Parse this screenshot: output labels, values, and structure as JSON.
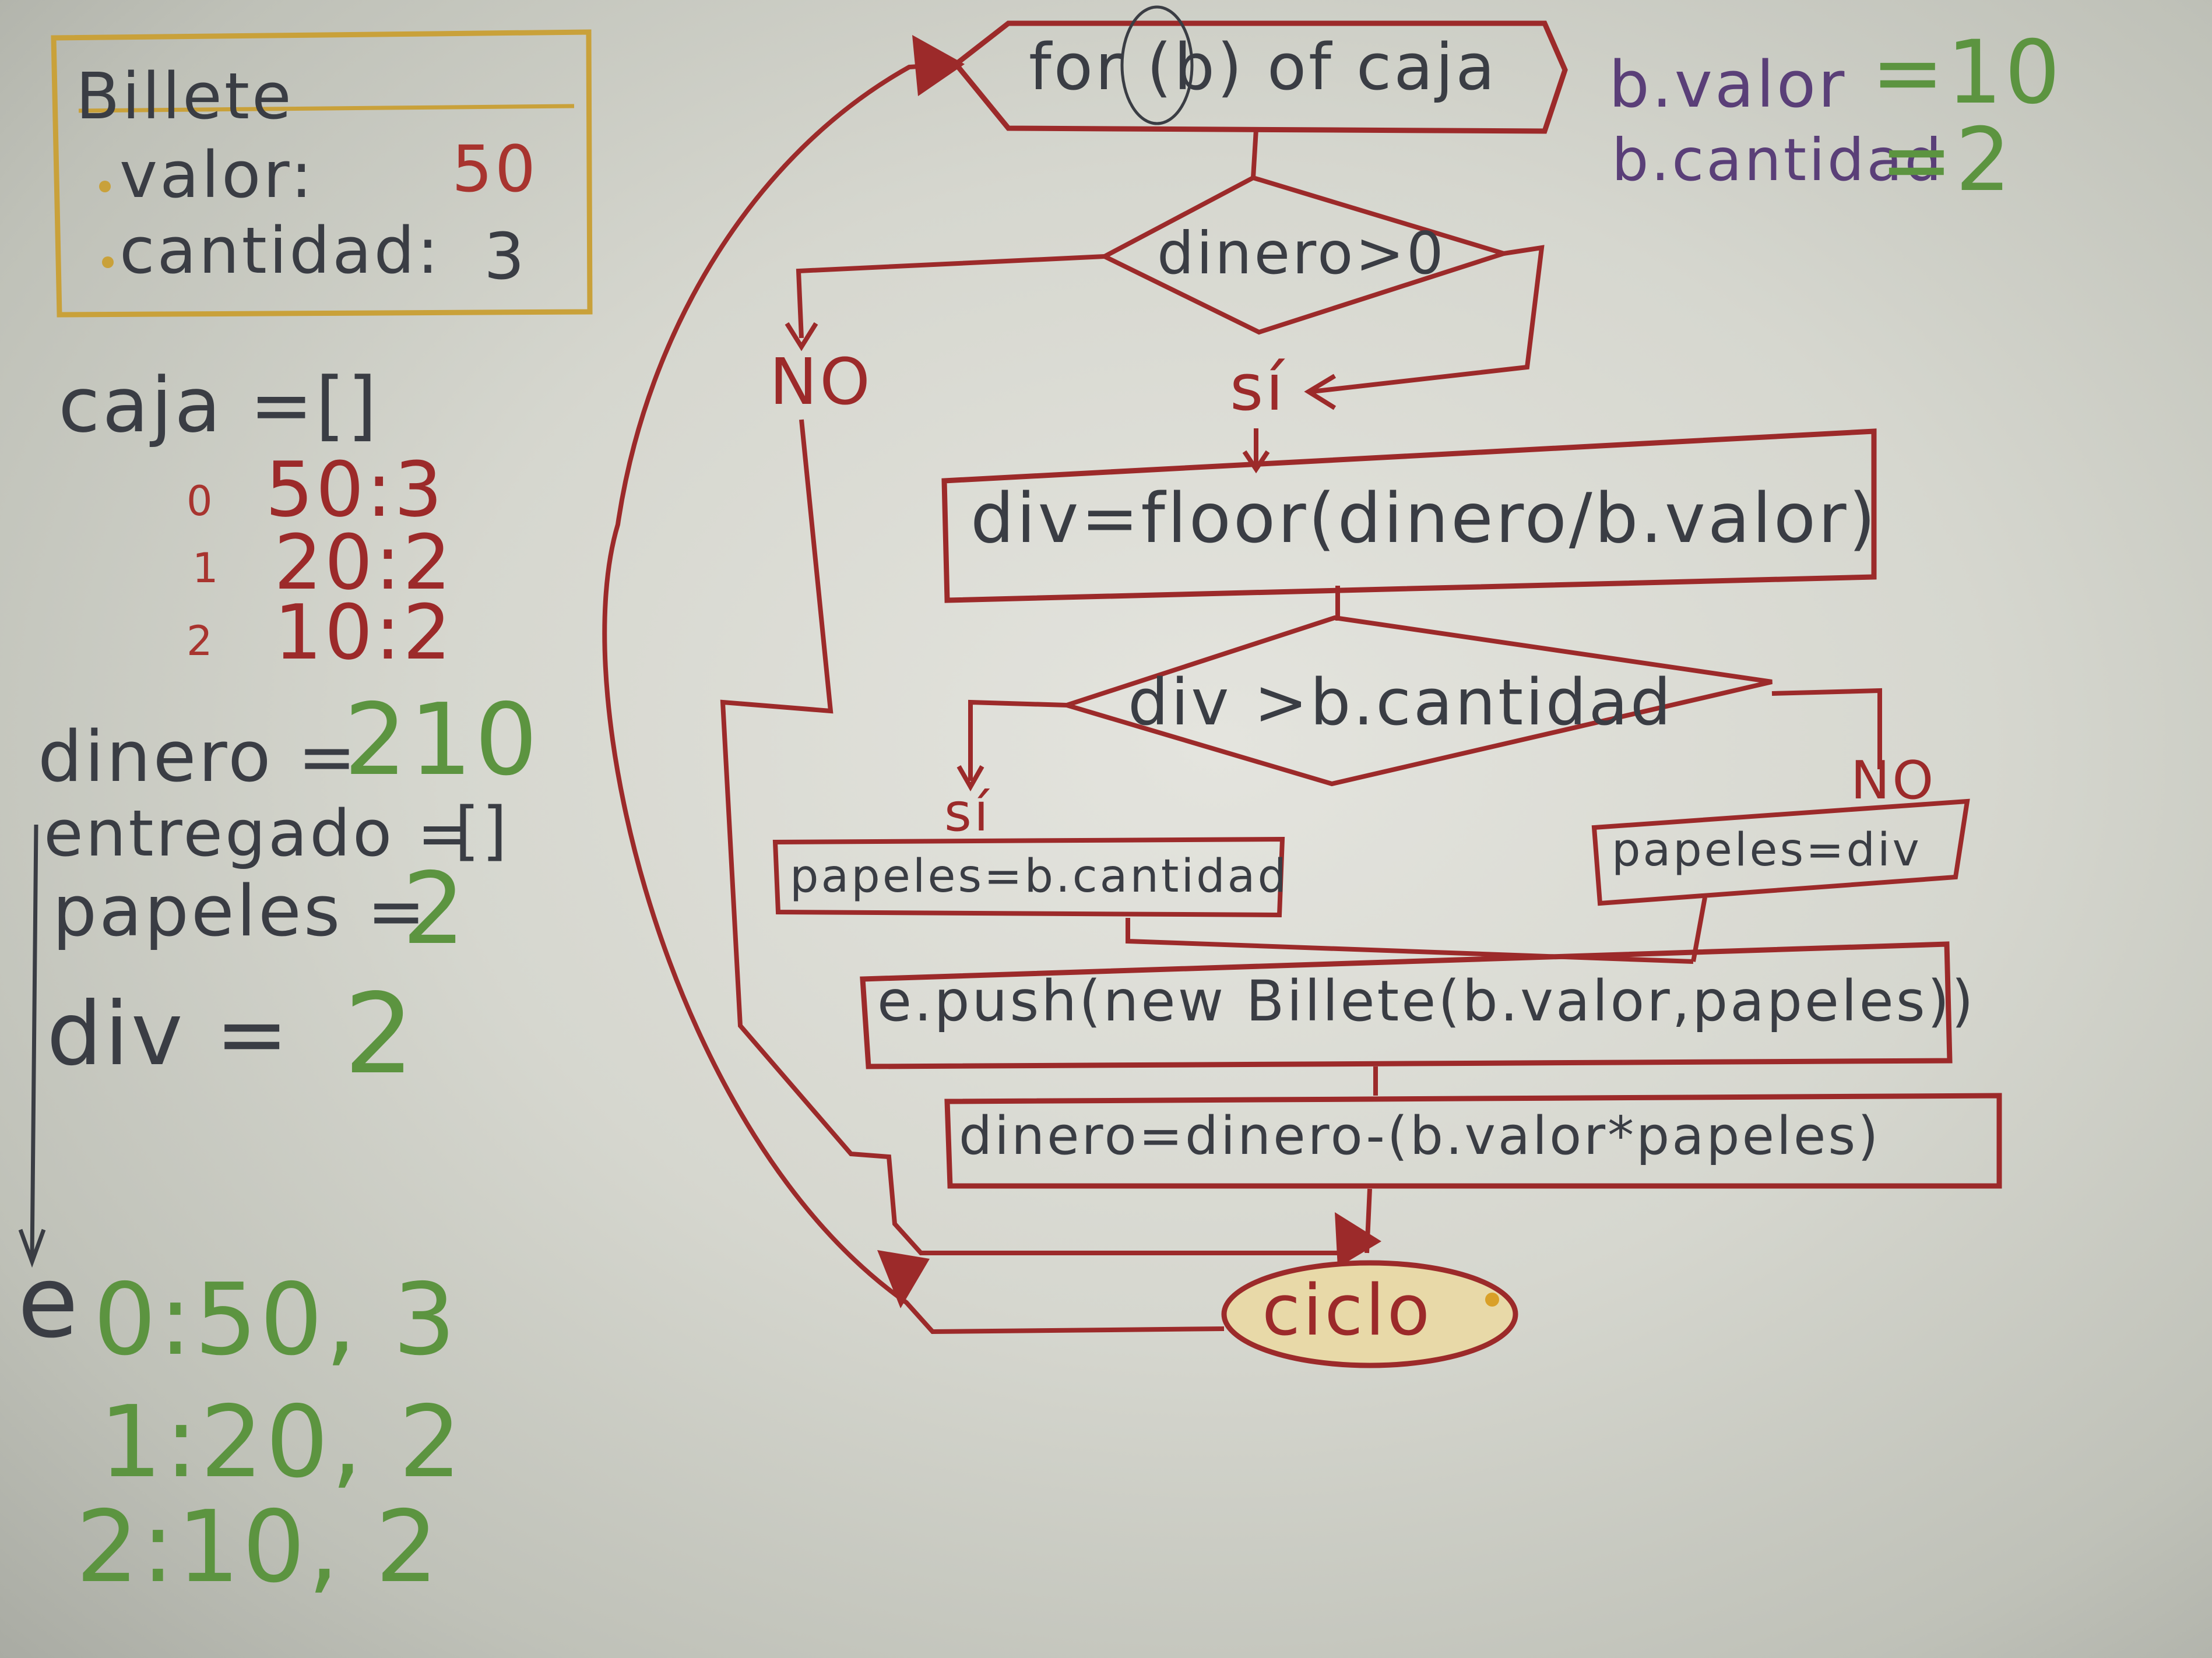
{
  "colors": {
    "board": "#d6d7cf",
    "red_marker": "#9c2a2a",
    "black_marker": "#3a3d44",
    "green_marker": "#5c9440",
    "purple_marker": "#5a3f78",
    "orange_marker": "#c9a13a",
    "ellipse_fill": "#e8d9a8"
  },
  "class_box": {
    "title": "Billete",
    "valor_label": "valor:",
    "valor_value": "50",
    "cantidad_label": "cantidad:",
    "cantidad_value": "3"
  },
  "caja": {
    "title": "caja =[]",
    "items": [
      {
        "index": "0",
        "value": "50:3"
      },
      {
        "index": "1",
        "value": "20:2"
      },
      {
        "index": "2",
        "value": "10:2"
      }
    ]
  },
  "vars": {
    "dinero_label": "dinero =",
    "dinero_value": "210",
    "entregado_label": "entregado =",
    "entregado_value": "[]",
    "papeles_label": "papeles =",
    "papeles_value": "2",
    "div_label": "div =",
    "div_value": "2"
  },
  "entregado_list": {
    "letter": "e",
    "items": [
      {
        "index": "0",
        "sep": ":",
        "valor": "50",
        "cantidad": "3"
      },
      {
        "index": "1",
        "sep": ":",
        "valor": "20",
        "cantidad": "2"
      },
      {
        "index": "2",
        "sep": ":",
        "valor": "10",
        "cantidad": "2"
      }
    ]
  },
  "current_b": {
    "valor_label": "b.valor",
    "valor_value": "=10",
    "cantidad_label": "b.cantidad",
    "cantidad_value": "=2"
  },
  "flowchart": {
    "loop": "for (b) of caja",
    "cond1": "dinero>0",
    "cond1_no": "NO",
    "cond1_yes": "sí",
    "step_div": "div=floor(dinero/b.valor)",
    "cond2": "div >b.cantidad",
    "cond2_yes": "sí",
    "cond2_no": "NO",
    "step_yes": "papeles=b.cantidad",
    "step_no": "papeles=div",
    "push": "e.push(new Billete(b.valor,papeles))",
    "update": "dinero=dinero-(b.valor*papeles)",
    "end": "ciclo"
  }
}
